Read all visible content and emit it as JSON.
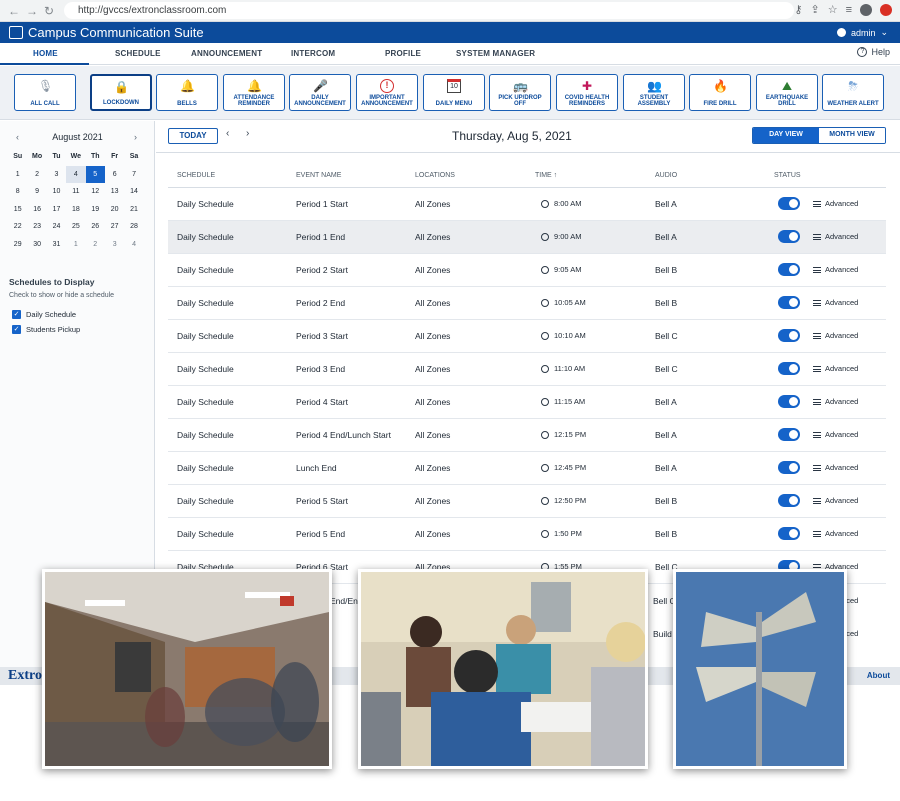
{
  "browser": {
    "url": "http://gvccs/extronclassroom.com"
  },
  "app": {
    "title": "Campus Communication Suite",
    "user": "admin"
  },
  "tabs": [
    "HOME",
    "SCHEDULE",
    "ANNOUNCEMENT",
    "INTERCOM",
    "PROFILE",
    "SYSTEM MANAGER"
  ],
  "help_label": "Help",
  "quick_actions": [
    {
      "label": "ALL CALL",
      "icon": "microphone-icon"
    },
    {
      "label": "LOCKDOWN",
      "icon": "padlock-icon"
    },
    {
      "label": "BELLS",
      "icon": "bell-icon"
    },
    {
      "label": "ATTENDANCE REMINDER",
      "icon": "bell-alert-icon"
    },
    {
      "label": "DAILY ANNOUNCEMENT",
      "icon": "microphone-icon"
    },
    {
      "label": "IMPORTANT ANNOUNCEMENT",
      "icon": "exclamation-icon"
    },
    {
      "label": "DAILY MENU",
      "icon": "calendar-icon"
    },
    {
      "label": "PICK UP/DROP OFF",
      "icon": "school-bus-icon"
    },
    {
      "label": "COVID HEALTH REMINDERS",
      "icon": "health-icon"
    },
    {
      "label": "STUDENT ASSEMBLY",
      "icon": "assembly-icon"
    },
    {
      "label": "FIRE DRILL",
      "icon": "fire-icon"
    },
    {
      "label": "EARTHQUAKE DRILL",
      "icon": "earthquake-icon"
    },
    {
      "label": "WEATHER ALERT",
      "icon": "weather-icon"
    }
  ],
  "calendar": {
    "month_label": "August 2021",
    "prev": "‹",
    "next": "›",
    "weekdays": [
      "Su",
      "Mo",
      "Tu",
      "We",
      "Th",
      "Fr",
      "Sa"
    ],
    "days": [
      "1",
      "2",
      "3",
      "4",
      "5",
      "6",
      "7",
      "8",
      "9",
      "10",
      "11",
      "12",
      "13",
      "14",
      "15",
      "16",
      "17",
      "18",
      "19",
      "20",
      "21",
      "22",
      "23",
      "24",
      "25",
      "26",
      "27",
      "28",
      "29",
      "30",
      "31",
      "1",
      "2",
      "3",
      "4"
    ],
    "today_index": 3,
    "selected_index": 4,
    "trailing_start_index": 31
  },
  "schedules_panel": {
    "title": "Schedules to Display",
    "hint": "Check to show or hide a schedule",
    "items": [
      "Daily Schedule",
      "Students Pickup"
    ]
  },
  "day_view": {
    "today_label": "TODAY",
    "prev": "‹",
    "next": "›",
    "date_title": "Thursday, Aug 5, 2021",
    "views": [
      "DAY VIEW",
      "MONTH VIEW"
    ]
  },
  "table": {
    "headers": [
      "SCHEDULE",
      "EVENT NAME",
      "LOCATIONS",
      "TIME ↑",
      "AUDIO",
      "STATUS"
    ],
    "advanced_label": "Advanced",
    "highlight_index": 1,
    "rows": [
      {
        "schedule": "Daily Schedule",
        "event": "Period 1 Start",
        "location": "All Zones",
        "time": "8:00 AM",
        "audio": "Bell A"
      },
      {
        "schedule": "Daily Schedule",
        "event": "Period 1 End",
        "location": "All Zones",
        "time": "9:00 AM",
        "audio": "Bell A"
      },
      {
        "schedule": "Daily Schedule",
        "event": "Period 2 Start",
        "location": "All Zones",
        "time": "9:05 AM",
        "audio": "Bell B"
      },
      {
        "schedule": "Daily Schedule",
        "event": "Period 2 End",
        "location": "All Zones",
        "time": "10:05 AM",
        "audio": "Bell B"
      },
      {
        "schedule": "Daily Schedule",
        "event": "Period 3 Start",
        "location": "All Zones",
        "time": "10:10 AM",
        "audio": "Bell C"
      },
      {
        "schedule": "Daily Schedule",
        "event": "Period 3 End",
        "location": "All Zones",
        "time": "11:10 AM",
        "audio": "Bell C"
      },
      {
        "schedule": "Daily Schedule",
        "event": "Period 4 Start",
        "location": "All Zones",
        "time": "11:15 AM",
        "audio": "Bell A"
      },
      {
        "schedule": "Daily Schedule",
        "event": "Period 4 End/Lunch Start",
        "location": "All Zones",
        "time": "12:15 PM",
        "audio": "Bell A"
      },
      {
        "schedule": "Daily Schedule",
        "event": "Lunch End",
        "location": "All Zones",
        "time": "12:45 PM",
        "audio": "Bell A"
      },
      {
        "schedule": "Daily Schedule",
        "event": "Period 5 Start",
        "location": "All Zones",
        "time": "12:50 PM",
        "audio": "Bell B"
      },
      {
        "schedule": "Daily Schedule",
        "event": "Period 5 End",
        "location": "All Zones",
        "time": "1:50 PM",
        "audio": "Bell B"
      },
      {
        "schedule": "Daily Schedule",
        "event": "Period 6 Start",
        "location": "All Zones",
        "time": "1:55 PM",
        "audio": "Bell C"
      }
    ]
  },
  "partial_rows": [
    "End/En",
    "Bell C",
    "Advanced",
    "Build",
    "Advanced"
  ],
  "footer": {
    "brand": "Extron",
    "about": "About"
  },
  "colors": {
    "brand": "#0c4b9b",
    "accent": "#1563c9"
  }
}
